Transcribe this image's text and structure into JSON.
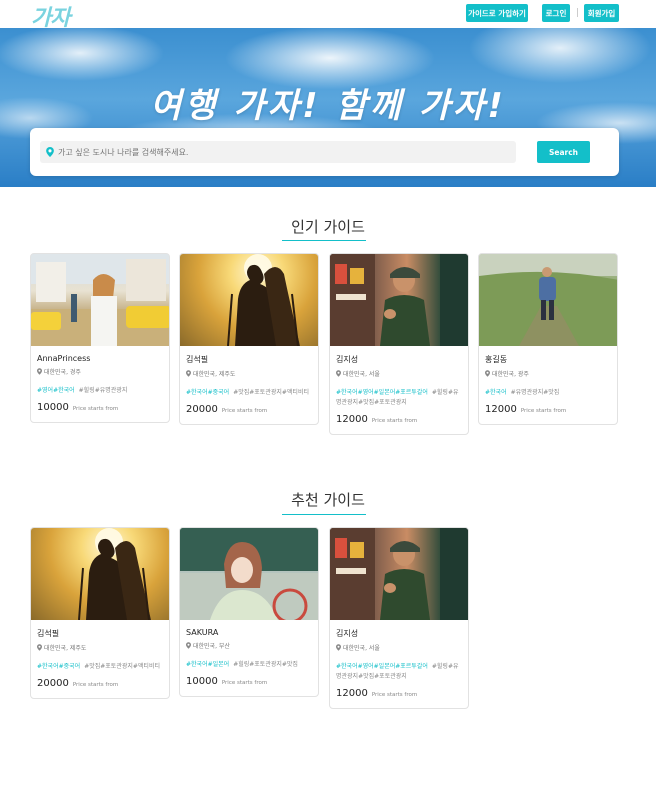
{
  "header": {
    "logo": "가자",
    "nav": {
      "guide_signup": "가이드로 가입하기",
      "login": "로그인",
      "signup": "회원가입"
    }
  },
  "hero": {
    "title": "여행 가자! 함께 가자!",
    "search": {
      "placeholder": "가고 싶은 도시나 나라를 검색해주세요.",
      "button": "Search"
    }
  },
  "sections": [
    {
      "title": "인기 가이드",
      "cards": [
        {
          "name": "AnnaPrincess",
          "location": "대한민국, 경주",
          "languages": "#영어#한국어",
          "themes": "#힐링#유명관광지",
          "price": "10000",
          "price_label": "Price starts from",
          "photo": "street"
        },
        {
          "name": "김석필",
          "location": "대한민국, 제주도",
          "languages": "#한국어#중국어",
          "themes": "#맛집#포토관광지#액티비티",
          "price": "20000",
          "price_label": "Price starts from",
          "photo": "sunset"
        },
        {
          "name": "김지성",
          "location": "대한민국, 서울",
          "languages": "#한국어#영어#일본어#포르투갈어",
          "themes": "#힐링#유명관광지#맛집#포토관광지",
          "price": "12000",
          "price_label": "Price starts from",
          "photo": "market"
        },
        {
          "name": "홍길동",
          "location": "대한민국, 광주",
          "languages": "#한국어",
          "themes": "#유명관광지#맛집",
          "price": "12000",
          "price_label": "Price starts from",
          "photo": "hill"
        }
      ]
    },
    {
      "title": "추천 가이드",
      "cards": [
        {
          "name": "김석필",
          "location": "대한민국, 제주도",
          "languages": "#한국어#중국어",
          "themes": "#맛집#포토관광지#액티비티",
          "price": "20000",
          "price_label": "Price starts from",
          "photo": "sunset"
        },
        {
          "name": "SAKURA",
          "location": "대한민국, 부산",
          "languages": "#한국어#일본어",
          "themes": "#힐링#포토관광지#맛집",
          "price": "10000",
          "price_label": "Price starts from",
          "photo": "court"
        },
        {
          "name": "김지성",
          "location": "대한민국, 서울",
          "languages": "#한국어#영어#일본어#포르투갈어",
          "themes": "#힐링#유명관광지#맛집#포토관광지",
          "price": "12000",
          "price_label": "Price starts from",
          "photo": "market"
        }
      ]
    }
  ],
  "colors": {
    "accent": "#13bfc9",
    "logo": "#7ad3df"
  },
  "icons": [
    "location-pin-icon"
  ]
}
